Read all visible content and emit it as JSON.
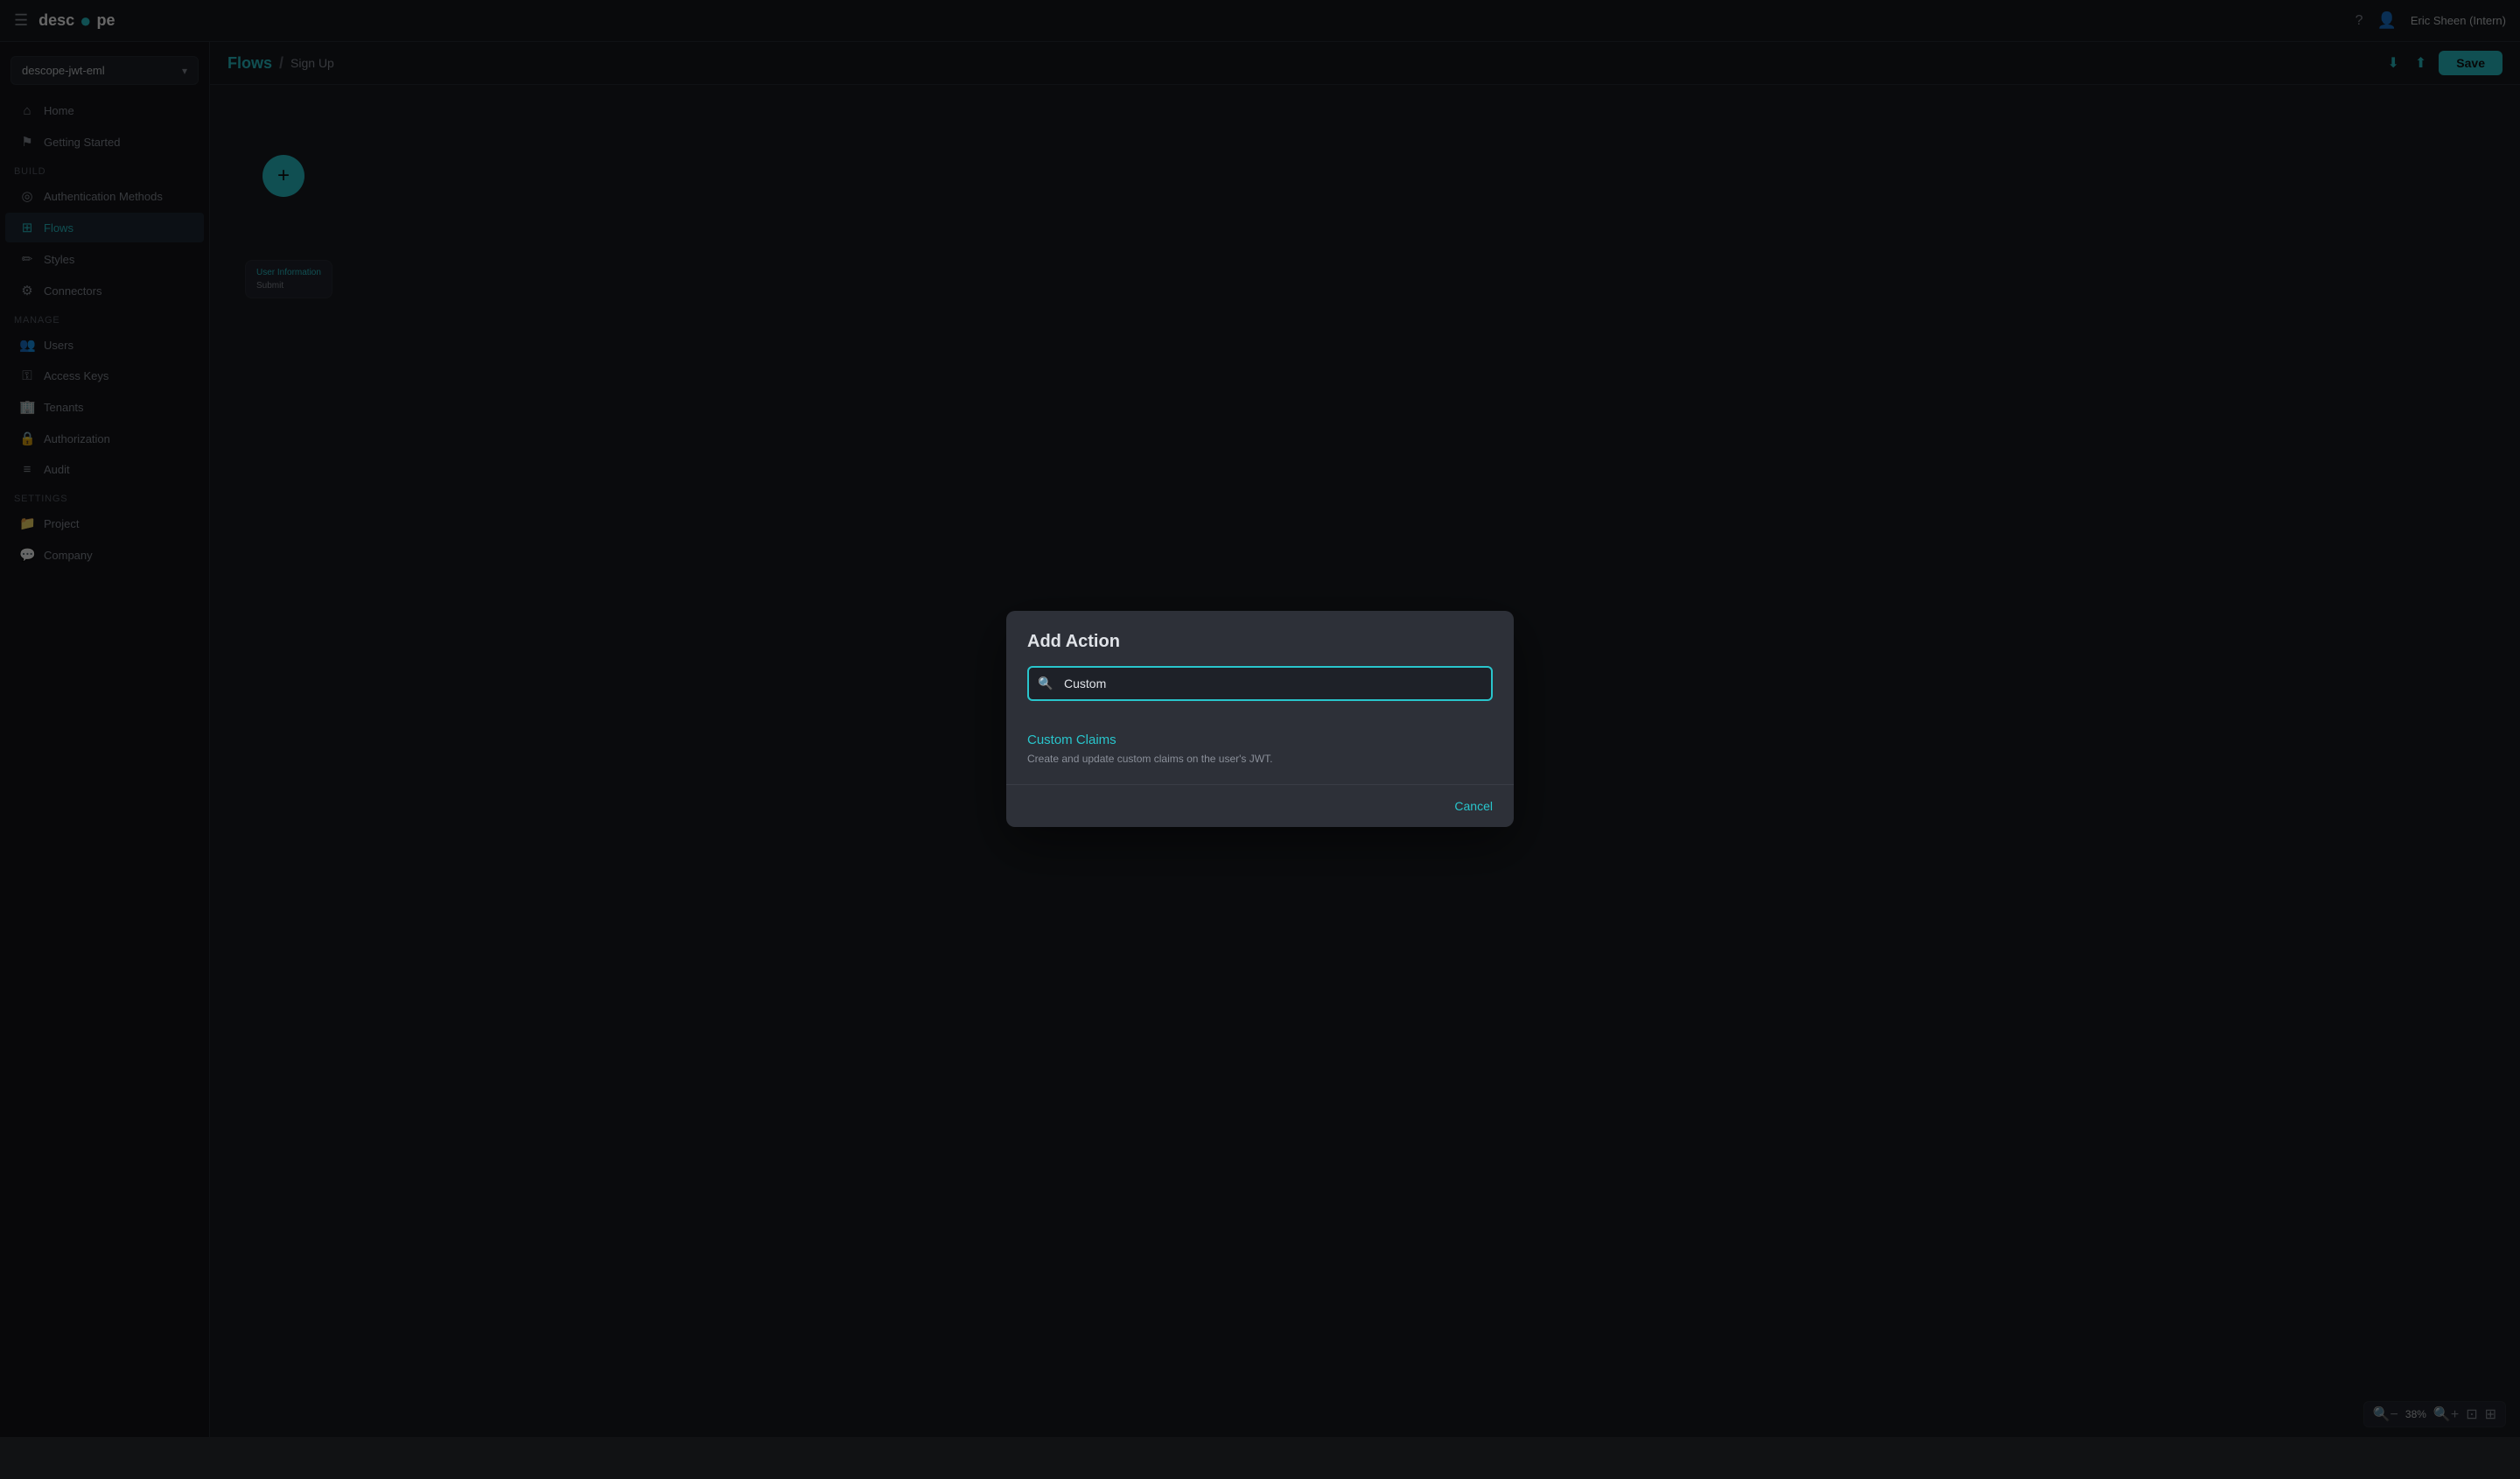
{
  "topbar": {
    "hamburger": "☰",
    "logo_text": "desc",
    "logo_accent": "●",
    "logo_suffix": "pe",
    "help_icon": "?",
    "user_label": "Eric Sheen (Intern)"
  },
  "sidebar": {
    "project_name": "descope-jwt-eml",
    "sections": [
      {
        "items": [
          {
            "id": "home",
            "label": "Home",
            "icon": "⌂"
          },
          {
            "id": "getting-started",
            "label": "Getting Started",
            "icon": "⚑"
          }
        ]
      },
      {
        "label": "Build",
        "items": [
          {
            "id": "authentication-methods",
            "label": "Authentication Methods",
            "icon": "◎"
          },
          {
            "id": "flows",
            "label": "Flows",
            "icon": "⊞",
            "active": true
          },
          {
            "id": "styles",
            "label": "Styles",
            "icon": "✏"
          },
          {
            "id": "connectors",
            "label": "Connectors",
            "icon": "⚙"
          }
        ]
      },
      {
        "label": "Manage",
        "items": [
          {
            "id": "users",
            "label": "Users",
            "icon": "👥"
          },
          {
            "id": "access-keys",
            "label": "Access Keys",
            "icon": "⚿"
          },
          {
            "id": "tenants",
            "label": "Tenants",
            "icon": "🏢"
          },
          {
            "id": "authorization",
            "label": "Authorization",
            "icon": "🔒"
          },
          {
            "id": "audit",
            "label": "Audit",
            "icon": "≡"
          }
        ]
      },
      {
        "label": "Settings",
        "items": [
          {
            "id": "project",
            "label": "Project",
            "icon": "📁"
          },
          {
            "id": "company",
            "label": "Company",
            "icon": "💬"
          }
        ]
      }
    ]
  },
  "content_header": {
    "breadcrumb_main": "Flows",
    "breadcrumb_sep": "/",
    "breadcrumb_sub": "Sign Up",
    "save_label": "Save"
  },
  "canvas": {
    "add_btn": "+",
    "node_title": "User Information",
    "node_submit": "Submit",
    "zoom_level": "38%"
  },
  "modal": {
    "title": "Add Action",
    "search_placeholder": "Custom",
    "search_value": "Custom",
    "results": [
      {
        "id": "custom-claims",
        "title": "Custom Claims",
        "description": "Create and update custom claims on the user's JWT."
      }
    ],
    "cancel_label": "Cancel"
  },
  "zoom_controls": {
    "zoom_out": "🔍",
    "zoom_in": "🔍",
    "zoom_level": "38%",
    "fit_icon": "⊡",
    "grid_icon": "⊞"
  }
}
